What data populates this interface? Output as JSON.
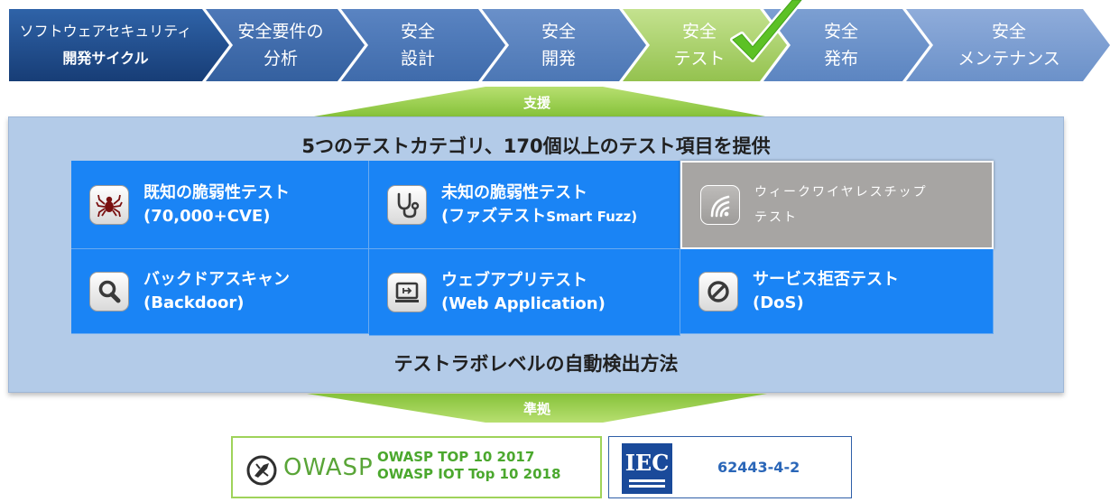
{
  "process_steps": [
    {
      "line1": "ソフトウェアセキュリティ",
      "line2": "開発サイクル"
    },
    {
      "line1": "安全要件の",
      "line2": "分析"
    },
    {
      "line1": "安全",
      "line2": "設計"
    },
    {
      "line1": "安全",
      "line2": "開発"
    },
    {
      "line1": "安全",
      "line2": "テスト"
    },
    {
      "line1": "安全",
      "line2": "発布"
    },
    {
      "line1": "安全",
      "line2": "メンテナンス"
    }
  ],
  "support_label": "支援",
  "conform_label": "準拠",
  "panel": {
    "title": "5つのテストカテゴリ、170個以上のテスト項目を提供",
    "footer": "テストラボレベルの自動検出方法",
    "categories": [
      {
        "line1": "既知の脆弱性テスト",
        "line2": "(70,000+CVE)",
        "icon": "spider-icon"
      },
      {
        "line1": "未知の脆弱性テスト",
        "line2a": "(ファズテスト",
        "line2b": "Smart Fuzz)",
        "icon": "stethoscope-icon"
      },
      {
        "line1": "ウィークワイヤレスチップ",
        "line2": "テスト",
        "icon": "wireless-icon"
      },
      {
        "line1": "バックドアスキャン",
        "line2": "(Backdoor)",
        "icon": "magnifier-icon"
      },
      {
        "line1": "ウェブアプリテスト",
        "line2": "(Web Application)",
        "icon": "monitor-icon"
      },
      {
        "line1": "サービス拒否テスト",
        "line2": "(DoS)",
        "icon": "prohibited-icon"
      }
    ]
  },
  "owasp": {
    "brand": "OWASP",
    "line1": "OWASP TOP 10  2017",
    "line2": "OWASP IOT Top 10 2018"
  },
  "iec": {
    "brand": "IEC",
    "standard": "62443-4-2"
  },
  "colors": {
    "step_dark": "#1e4b8a",
    "step_mid": "#5f86c4",
    "step_active": "#a8d06a",
    "cell_blue": "#1a84f5",
    "cell_gray": "#a7a5a3",
    "panel_bg": "#b3cbe8",
    "check_green": "#5cc125"
  }
}
